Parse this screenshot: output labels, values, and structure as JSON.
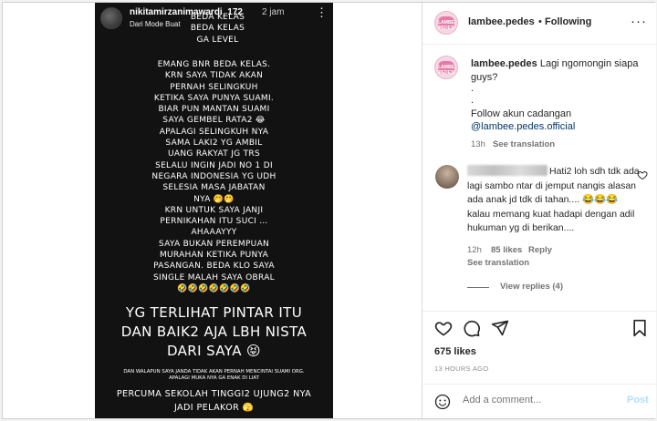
{
  "story": {
    "username": "nikitamirzanimawardi_172",
    "time": "2 jam",
    "subtitle": "Dari Mode Buat",
    "more": "⋮",
    "block1": [
      "BEDA KELAS",
      "BEDA KELAS",
      "GA LEVEL"
    ],
    "block2": [
      "EMANG BNR BEDA KELAS.",
      "KRN SAYA TIDAK AKAN",
      "PERNAH SELINGKUH",
      "KETIKA SAYA PUNYA SUAMI.",
      "BIAR PUN MANTAN SUAMI",
      "SAYA GEMBEL RATA2 😂",
      "APALAGI SELINGKUH NYA",
      "SAMA LAKI2 YG AMBIL",
      "UANG RAKYAT JG TRS",
      "SELALU INGIN JADI NO 1 DI",
      "NEGARA INDONESIA YG UDH",
      "SELESIA MASA JABATAN",
      "NYA 🤭🤭",
      "KRN UNTUK SAYA JANJI",
      "PERNIKAHAN ITU SUCI …",
      "AHAAAYYY",
      "SAYA BUKAN PEREMPUAN",
      "MURAHAN KETIKA PUNYA",
      "PASANGAN. BEDA KLO SAYA",
      "SINGLE MALAH SAYA OBRAL",
      "🤣🤣🤣🤣🤣🤣🤣"
    ],
    "block3": [
      "YG TERLIHAT PINTAR ITU",
      "DAN BAIK2 AJA LBH NISTA",
      "DARI SAYA 😝"
    ],
    "block4": [
      "DAN WALAPUN SAYA JANDA TIDAK AKAN PERNAH MENCINTAI SUAMI ORG.",
      "APALAGI MUKA NYA GA ENAK DI LIAT"
    ],
    "block5": [
      "PERCUMA SEKOLAH TINGGI2 UJUNG2 NYA",
      "JADI PELAKOR 🫣"
    ]
  },
  "header": {
    "avatar_text": "LAMBE PEDES",
    "username": "lambee.pedes",
    "dot": "•",
    "following": "Following",
    "more": "···"
  },
  "caption": {
    "username": "lambee.pedes",
    "text": "Lagi ngomongin siapa guys?",
    "dot1": ".",
    "dot2": ".",
    "follow_text": "Follow akun cadangan",
    "link": "@lambee.pedes.official",
    "time": "13h",
    "see_translation": "See translation"
  },
  "comment": {
    "text": "Hati2 loh sdh tdk ada lagi sambo ntar di jemput nangis alasan ada anak jd tdk di tahan.... 😂😂😂 kalau memang kuat hadapi dengan adil hukuman yg di berikan....",
    "time": "12h",
    "likes": "85 likes",
    "reply": "Reply",
    "see_translation": "See translation",
    "view_replies": "View replies (4)"
  },
  "post": {
    "likes": "675 likes",
    "posted": "13 HOURS AGO",
    "add_comment_placeholder": "Add a comment...",
    "post_button": "Post"
  },
  "colors": {
    "link": "#00376b",
    "meta": "#737373",
    "post_disabled": "#b2dffc"
  }
}
